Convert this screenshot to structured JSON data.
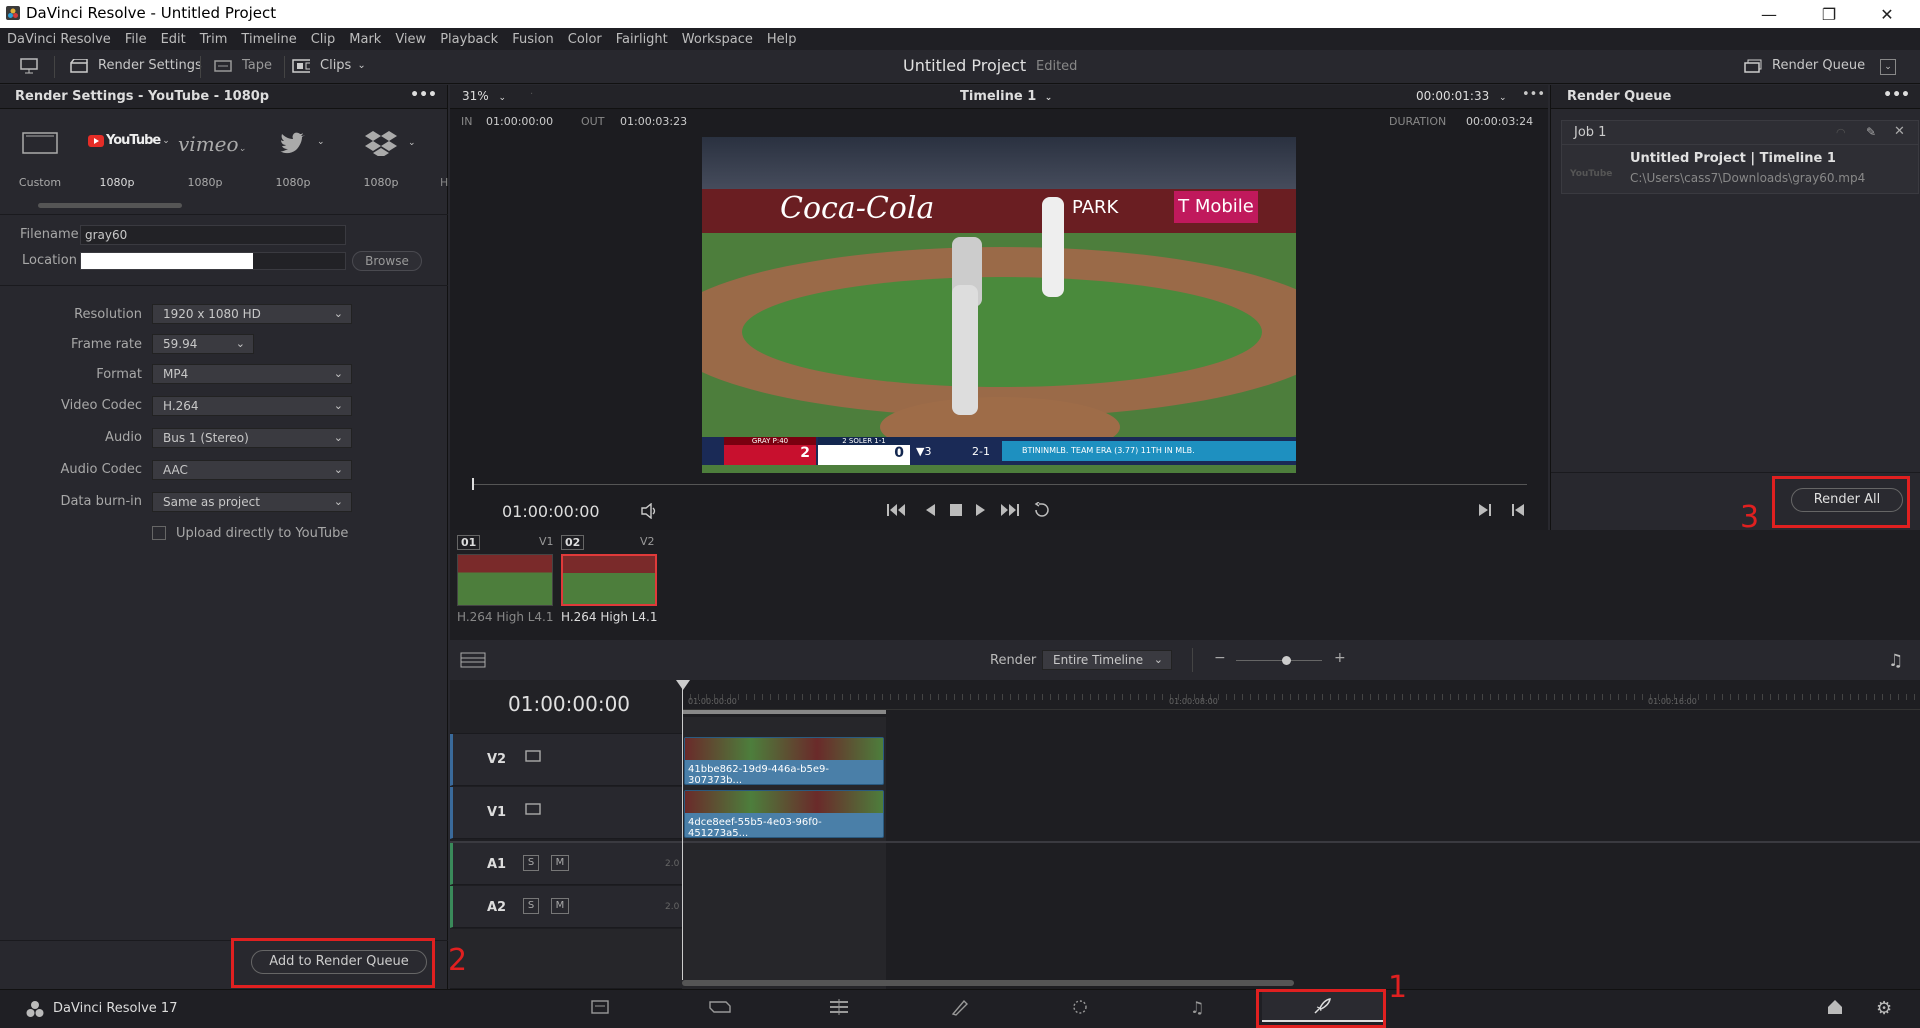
{
  "window": {
    "title": "DaVinci Resolve - Untitled Project"
  },
  "menu": [
    "DaVinci Resolve",
    "File",
    "Edit",
    "Trim",
    "Timeline",
    "Clip",
    "Mark",
    "View",
    "Playback",
    "Fusion",
    "Color",
    "Fairlight",
    "Workspace",
    "Help"
  ],
  "toolbar": {
    "render_settings": "Render Settings",
    "tape": "Tape",
    "clips": "Clips",
    "project_name": "Untitled Project",
    "project_status": "Edited",
    "render_queue": "Render Queue"
  },
  "render_settings": {
    "header": "Render Settings - YouTube - 1080p",
    "presets": [
      {
        "name": "Custom",
        "label": "Custom"
      },
      {
        "name": "YouTube",
        "label": "1080p"
      },
      {
        "name": "vimeo",
        "label": "1080p"
      },
      {
        "name": "twitter",
        "label": "1080p"
      },
      {
        "name": "dropbox",
        "label": "1080p"
      },
      {
        "name": "more",
        "label": "H"
      }
    ],
    "filename_label": "Filename",
    "filename_value": "gray60",
    "location_label": "Location",
    "browse": "Browse",
    "resolution_label": "Resolution",
    "resolution_value": "1920 x 1080 HD",
    "framerate_label": "Frame rate",
    "framerate_value": "59.94",
    "format_label": "Format",
    "format_value": "MP4",
    "vcodec_label": "Video Codec",
    "vcodec_value": "H.264",
    "audio_label": "Audio",
    "audio_value": "Bus 1 (Stereo)",
    "acodec_label": "Audio Codec",
    "acodec_value": "AAC",
    "burnin_label": "Data burn-in",
    "burnin_value": "Same as project",
    "upload_label": "Upload directly to YouTube",
    "add_queue": "Add to Render Queue"
  },
  "viewer": {
    "zoom": "31%",
    "timeline_name": "Timeline 1",
    "timecode_top": "00:00:01:33",
    "in_label": "IN",
    "in_value": "01:00:00:00",
    "out_label": "OUT",
    "out_value": "01:00:03:23",
    "duration_label": "DURATION",
    "duration_value": "00:00:03:24",
    "timecode": "01:00:00:00",
    "video": {
      "sign1": "Coca-Cola",
      "sign2": "PARK",
      "sign3": "T Mobile",
      "score_team1_pitcher": "GRAY P:40",
      "score_team1": "2",
      "score_team2_batter": "2 SOLER 1-1",
      "score_team2": "0",
      "inning": "▼3",
      "count": "2-1",
      "ticker": "BTININMLB. TEAM ERA (3.77) 11TH IN MLB."
    }
  },
  "render_queue": {
    "header": "Render Queue",
    "job_title": "Job 1",
    "job_name": "Untitled Project | Timeline 1",
    "job_path": "C:\\Users\\cass7\\Downloads\\gray60.mp4",
    "job_preset": "YouTube",
    "render_all": "Render All"
  },
  "clips": [
    {
      "num": "01",
      "track": "V1",
      "codec": "H.264 High L4.1"
    },
    {
      "num": "02",
      "track": "V2",
      "codec": "H.264 High L4.1"
    }
  ],
  "timeline_bar": {
    "render_label": "Render",
    "render_value": "Entire Timeline"
  },
  "timeline": {
    "timecode": "01:00:00:00",
    "ruler": [
      "01:00:00:00",
      "01:00:08:00",
      "01:00:16:00"
    ],
    "tracks": [
      {
        "name": "V2",
        "clip": "41bbe862-19d9-446a-b5e9-307373b..."
      },
      {
        "name": "V1",
        "clip": "4dce8eef-55b5-4e03-96f0-451273a5..."
      },
      {
        "name": "A1",
        "s": "S",
        "m": "M",
        "level": "2.0"
      },
      {
        "name": "A2",
        "s": "S",
        "m": "M",
        "level": "2.0"
      }
    ]
  },
  "bottom": {
    "app": "DaVinci Resolve 17"
  },
  "annotations": [
    "1",
    "2",
    "3"
  ]
}
